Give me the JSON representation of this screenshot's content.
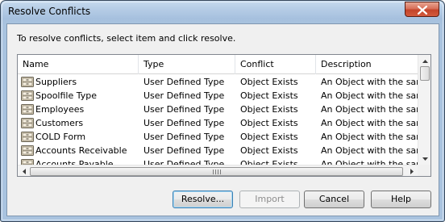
{
  "window": {
    "title": "Resolve Conflicts",
    "close_icon": "close-icon"
  },
  "instruction": "To resolve conflicts, select item and click resolve.",
  "list": {
    "columns": [
      "Name",
      "Type",
      "Conflict",
      "Description"
    ],
    "rows": [
      {
        "name": "Suppliers",
        "type": "User Defined Type",
        "conflict": "Object Exists",
        "description": "An Object with the sam..."
      },
      {
        "name": "Spoolfile Type",
        "type": "User Defined Type",
        "conflict": "Object Exists",
        "description": "An Object with the sam..."
      },
      {
        "name": "Employees",
        "type": "User Defined Type",
        "conflict": "Object Exists",
        "description": "An Object with the sam..."
      },
      {
        "name": "Customers",
        "type": "User Defined Type",
        "conflict": "Object Exists",
        "description": "An Object with the sam..."
      },
      {
        "name": "COLD Form",
        "type": "User Defined Type",
        "conflict": "Object Exists",
        "description": "An Object with the sam..."
      },
      {
        "name": "Accounts Receivable",
        "type": "User Defined Type",
        "conflict": "Object Exists",
        "description": "An Object with the sam..."
      },
      {
        "name": "Accounts Payable",
        "type": "User Defined Type",
        "conflict": "Object Exists",
        "description": "An Object with the sam..."
      }
    ],
    "row_icon": "cabinet-icon"
  },
  "buttons": {
    "resolve": "Resolve...",
    "import": "Import",
    "cancel": "Cancel",
    "help": "Help"
  },
  "colors": {
    "title_bar": "#b6cde6",
    "close_button": "#c4442a",
    "dialog_bg": "#f0f0f0",
    "focus_border": "#3c7fb1"
  }
}
